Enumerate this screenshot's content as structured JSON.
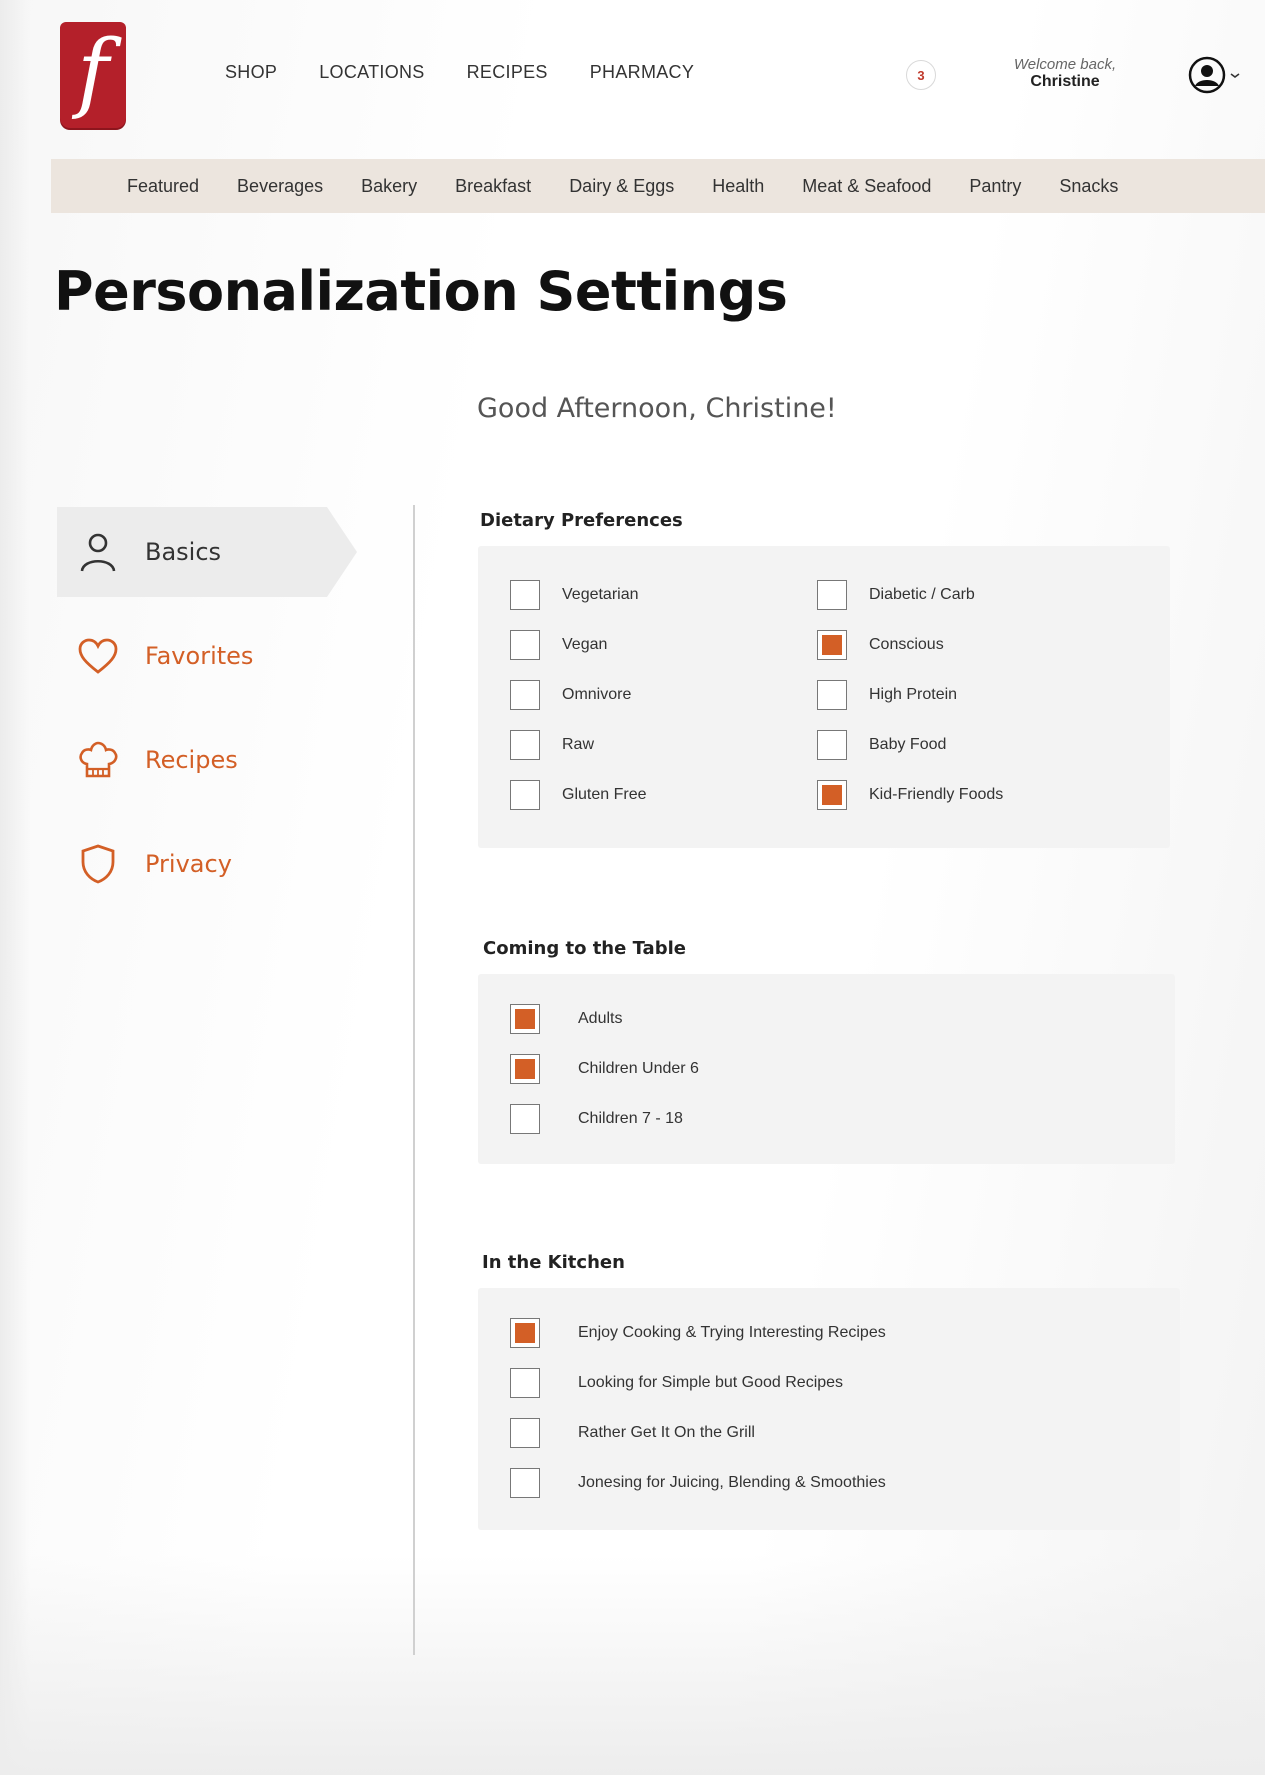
{
  "header": {
    "logo_letter": "f",
    "nav": [
      "SHOP",
      "LOCATIONS",
      "RECIPES",
      "PHARMACY"
    ],
    "cart_count": "3",
    "welcome_text": "Welcome back,",
    "user_name": "Christine"
  },
  "categories": [
    "Featured",
    "Beverages",
    "Bakery",
    "Breakfast",
    "Dairy & Eggs",
    "Health",
    "Meat & Seafood",
    "Pantry",
    "Snacks"
  ],
  "page": {
    "title": "Personalization Settings",
    "greeting": "Good Afternoon, Christine!"
  },
  "sidebar": {
    "items": [
      {
        "label": "Basics",
        "icon": "user-icon",
        "active": true
      },
      {
        "label": "Favorites",
        "icon": "heart-icon",
        "active": false
      },
      {
        "label": "Recipes",
        "icon": "chef-hat-icon",
        "active": false
      },
      {
        "label": "Privacy",
        "icon": "shield-icon",
        "active": false
      }
    ]
  },
  "sections": {
    "dietary": {
      "title": "Dietary Preferences",
      "options": [
        {
          "label": "Vegetarian",
          "checked": false
        },
        {
          "label": "Vegan",
          "checked": false
        },
        {
          "label": "Omnivore",
          "checked": false
        },
        {
          "label": "Raw",
          "checked": false
        },
        {
          "label": "Gluten Free",
          "checked": false
        },
        {
          "label": "Diabetic / Carb",
          "checked": false
        },
        {
          "label": "Conscious",
          "checked": true
        },
        {
          "label": "High Protein",
          "checked": false
        },
        {
          "label": "Baby Food",
          "checked": false
        },
        {
          "label": "Kid-Friendly Foods",
          "checked": true
        }
      ]
    },
    "table": {
      "title": "Coming to the Table",
      "options": [
        {
          "label": "Adults",
          "checked": true
        },
        {
          "label": "Children Under 6",
          "checked": true
        },
        {
          "label": "Children 7 - 18",
          "checked": false
        }
      ]
    },
    "kitchen": {
      "title": "In the Kitchen",
      "options": [
        {
          "label": "Enjoy Cooking & Trying Interesting Recipes",
          "checked": true
        },
        {
          "label": "Looking for Simple but Good Recipes",
          "checked": false
        },
        {
          "label": "Rather Get It On the Grill",
          "checked": false
        },
        {
          "label": "Jonesing for Juicing, Blending & Smoothies",
          "checked": false
        }
      ]
    }
  },
  "colors": {
    "brand_red": "#b4202a",
    "accent_orange": "#d35f26",
    "category_bar": "#ece5de"
  }
}
